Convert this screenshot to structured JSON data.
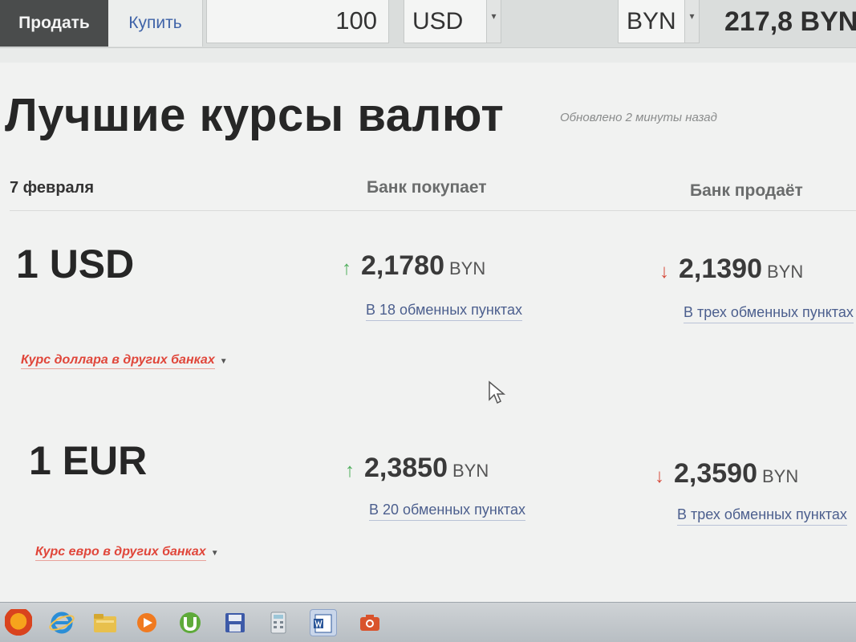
{
  "converter": {
    "tab_sell": "Продать",
    "tab_buy": "Купить",
    "amount": "100",
    "from_currency": "USD",
    "to_currency": "BYN",
    "result": "217,8 BYN"
  },
  "rates": {
    "title": "Лучшие курсы валют",
    "updated": "Обновлено 2 минуты назад",
    "date": "7 февраля",
    "col_buy": "Банк покупает",
    "col_sell": "Банк продаёт",
    "rows": [
      {
        "currency": "1 USD",
        "buy_rate": "2,1780",
        "buy_unit": "BYN",
        "buy_points": "В 18 обменных пунктах",
        "sell_rate": "2,1390",
        "sell_unit": "BYN",
        "sell_points": "В трех обменных пунктах",
        "other_link": "Курс доллара в других банках"
      },
      {
        "currency": "1 EUR",
        "buy_rate": "2,3850",
        "buy_unit": "BYN",
        "buy_points": "В 20 обменных пунктах",
        "sell_rate": "2,3590",
        "sell_unit": "BYN",
        "sell_points": "В трех обменных пунктах",
        "other_link": "Курс евро в других банках"
      }
    ]
  },
  "icons": {
    "up_arrow": "↑",
    "down_arrow": "↓",
    "caret": "▼",
    "select_arrow": "▾"
  },
  "colors": {
    "up": "#4fae5c",
    "down": "#d64b3b",
    "link": "#4c5f8e",
    "other_link": "#e0463a"
  },
  "taskbar": {
    "apps": [
      "firefox-icon",
      "internet-explorer-icon",
      "file-explorer-icon",
      "media-player-icon",
      "utorrent-icon",
      "save-icon",
      "calculator-icon",
      "word-icon",
      "camera-icon"
    ]
  }
}
